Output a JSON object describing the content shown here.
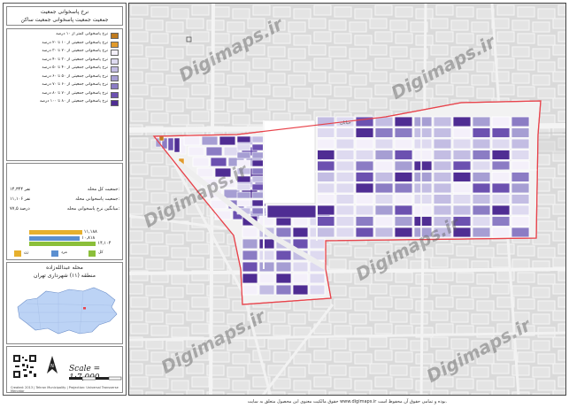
{
  "panel": {
    "title_line1": "نرخ پاسخوانی جمعیت",
    "title_line2": "جمعیت جمعیت پاسخوانی جمعیت ساکن",
    "legend": [
      {
        "label": "نرخ پاسخوانی کمتر از ۱۰ درصد",
        "color": "#c07b1e"
      },
      {
        "label": "نرخ پاسخوانی جمعیتی از ۱۰ تا ۲۰ درصد",
        "color": "#e19a2b"
      },
      {
        "label": "نرخ پاسخوانی جمعیتی از ۲۰ تا ۳۰ درصد",
        "color": "#f4f0fa"
      },
      {
        "label": "نرخ پاسخوانی جمعیتی از ۳۰ تا ۴۰ درصد",
        "color": "#dedaf0"
      },
      {
        "label": "نرخ پاسخوانی جمعیتی از ۴۰ تا ۵۰ درصد",
        "color": "#c3bde3"
      },
      {
        "label": "نرخ پاسخوانی جمعیتی از ۵۰ تا ۶۰ درصد",
        "color": "#a69ed3"
      },
      {
        "label": "نرخ پاسخوانی جمعیتی از ۶۰ تا ۷۰ درصد",
        "color": "#8b7cc4"
      },
      {
        "label": "نرخ پاسخوانی جمعیتی از ۷۰ تا ۸۰ درصد",
        "color": "#6c51b0"
      },
      {
        "label": "نرخ پاسخوانی جمعیتی از ۸۰ تا ۱۰۰ درصد",
        "color": "#4f2d93"
      }
    ],
    "stats": [
      {
        "label": "جمعیت کل محله:",
        "value": "۱۴,۳۴۴ نفر"
      },
      {
        "label": "جمعیت پاسخوانی محله:",
        "value": "۱۱,۱۰۶ نفر"
      },
      {
        "label": "میانگین نرخ پاسخوانی محله:",
        "value": "۷۷,۵ درصد"
      }
    ],
    "bars": [
      {
        "value_text": "۱۱,۱۸۸",
        "color": "#e6b02e",
        "length": 0.46
      },
      {
        "value_text": "۱۰,۸۱۸",
        "color": "#5b8fd0",
        "length": 0.44
      },
      {
        "value_text": "۱۴,۱۰۴",
        "color": "#8bbf3a",
        "length": 0.58
      }
    ],
    "bar_legend": [
      {
        "label": "زن",
        "color": "#e6b02e"
      },
      {
        "label": "مرد",
        "color": "#5b8fd0"
      },
      {
        "label": "کل",
        "color": "#8bbf3a"
      }
    ],
    "location_title1": "محله عبدالله‌زاده",
    "location_title2": "منطقه (۱۱) شهرداری تهران",
    "scale": "Scale = 1:7,000",
    "credit": "Created: 2013 | Tehran Municipality | Projection: Universal Transverse Mercator"
  },
  "map": {
    "watermark": "Digimaps.ir",
    "district_fill": "#bcd3f5",
    "highlight": "#e8434b",
    "road_label": "خیابان"
  },
  "footer": "حقوق مالکیت معنوی این محصول متعلق به سایت www.digimaps.ir بوده و تمامی حقوق آن محفوظ است."
}
